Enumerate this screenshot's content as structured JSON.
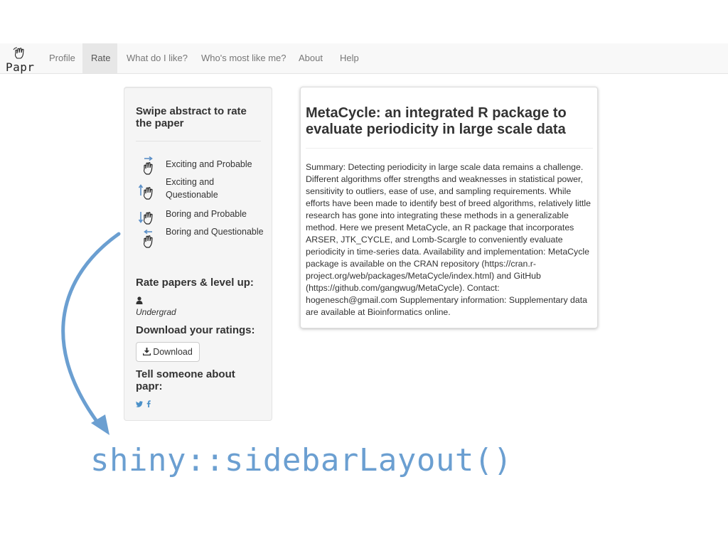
{
  "brand": {
    "text": "Papr",
    "icon": "hand-swipe-icon"
  },
  "nav": {
    "items": [
      {
        "label": "Profile",
        "active": false
      },
      {
        "label": "Rate",
        "active": true
      },
      {
        "label": "What do I like?",
        "active": false
      },
      {
        "label": "Who's most like me?",
        "active": false
      },
      {
        "label": "About",
        "active": false
      },
      {
        "label": "Help",
        "active": false
      }
    ]
  },
  "sidebar": {
    "swipe_title": "Swipe abstract to rate the paper",
    "legend": [
      {
        "label": "Exciting and Probable",
        "icon": "swipe-right-icon"
      },
      {
        "label": "Exciting and Questionable",
        "icon": "swipe-up-icon"
      },
      {
        "label": "Boring and Probable",
        "icon": "swipe-down-icon"
      },
      {
        "label": "Boring and Questionable",
        "icon": "swipe-left-icon"
      }
    ],
    "level_title": "Rate papers & level up:",
    "rank": "Undergrad",
    "download_title": "Download your ratings:",
    "download_label": "Download",
    "share_title": "Tell someone about papr:",
    "share_icons": [
      "twitter-icon",
      "facebook-icon"
    ]
  },
  "paper": {
    "title": "MetaCycle: an integrated R package to evaluate periodicity in large scale data",
    "abstract": "Summary: Detecting periodicity in large scale data remains a challenge. Different algorithms offer strengths and weaknesses in statistical power, sensitivity to outliers, ease of use, and sampling requirements. While efforts have been made to identify best of breed algorithms, relatively little research has gone into integrating these methods in a generalizable method. Here we present MetaCycle, an R package that incorporates ARSER, JTK_CYCLE, and Lomb-Scargle to conveniently evaluate periodicity in time-series data. Availability and implementation: MetaCycle package is available on the CRAN repository (https://cran.r-project.org/web/packages/MetaCycle/index.html) and GitHub (https://github.com/gangwug/MetaCycle). Contact: hogenesch@gmail.com Supplementary information: Supplementary data are available at Bioinformatics online."
  },
  "annotation": {
    "caption": "shiny::sidebarLayout()",
    "color": "#6b9fd1"
  },
  "colors": {
    "navbar_bg": "#f8f8f8",
    "active_tab_bg": "#e7e7e7",
    "sidebar_bg": "#f5f5f5"
  }
}
